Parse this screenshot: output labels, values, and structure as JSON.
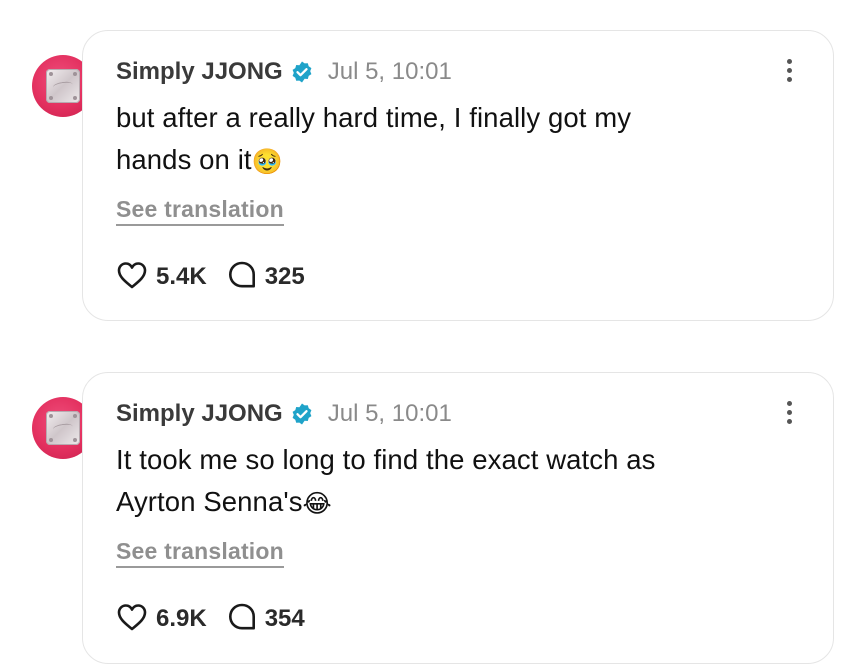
{
  "posts": [
    {
      "author": "Simply JJONG",
      "timestamp": "Jul 5, 10:01",
      "text_line1": "but after a really hard time, I finally got my",
      "text_line2": "hands on it",
      "emoji": "🥹",
      "emoji_name": "pleading-face-emoji",
      "translate_label": "See translation",
      "likes": "5.4K",
      "comments": "325"
    },
    {
      "author": "Simply JJONG",
      "timestamp": "Jul 5, 10:01",
      "text_line1": "It took me so long to find the exact watch as",
      "text_line2": "Ayrton Senna's",
      "emoji": "😂",
      "emoji_name": "tears-of-joy-emoji",
      "translate_label": "See translation",
      "likes": "6.9K",
      "comments": "354"
    }
  ],
  "colors": {
    "avatar_bg": "#e3305f",
    "verified_badge": "#1fa3c9",
    "muted_text": "#8a8a8a",
    "card_border": "#e5e5e5"
  },
  "icons": [
    "verified-badge-icon",
    "more-options-icon",
    "heart-icon",
    "comment-bubble-icon"
  ]
}
